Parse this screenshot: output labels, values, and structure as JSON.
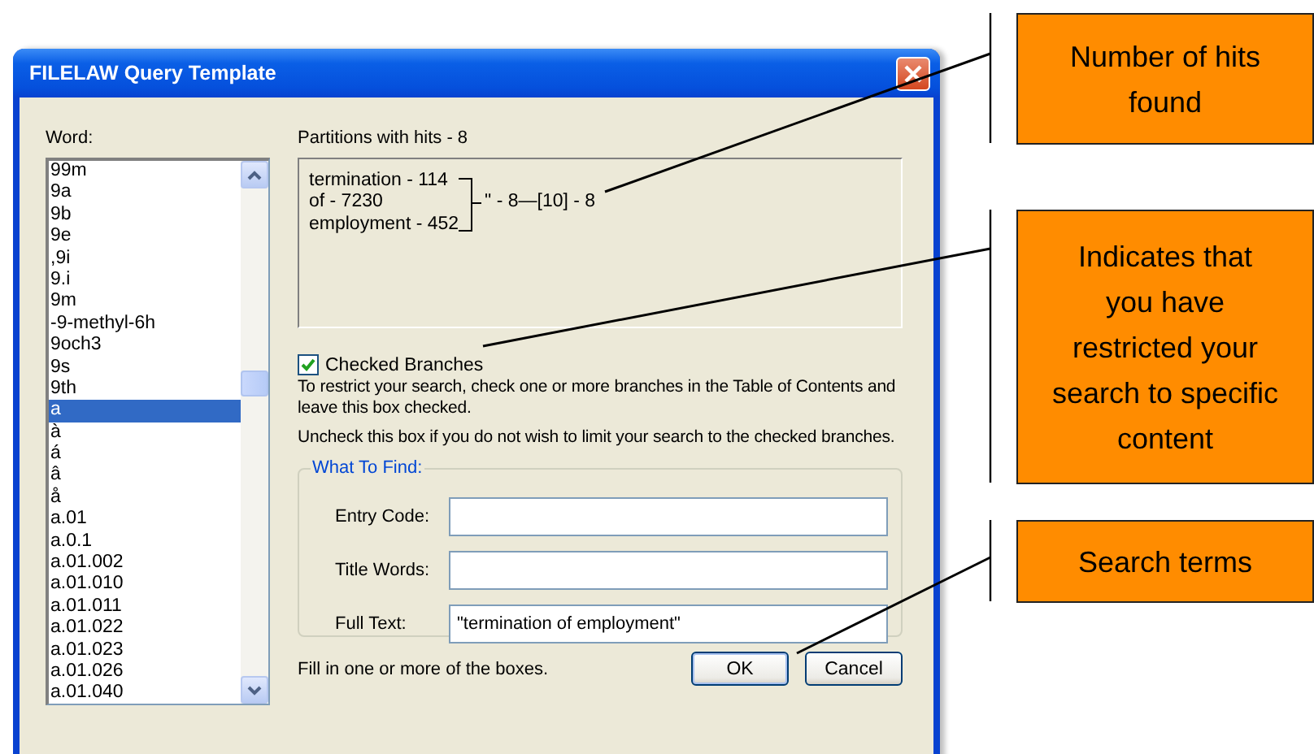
{
  "window": {
    "title": "FILELAW Query Template"
  },
  "word_list": {
    "label": "Word:",
    "items": [
      {
        "text": "99m",
        "selected": false
      },
      {
        "text": "9a",
        "selected": false
      },
      {
        "text": "9b",
        "selected": false
      },
      {
        "text": "9e",
        "selected": false
      },
      {
        "text": ",9i",
        "selected": false
      },
      {
        "text": "9.i",
        "selected": false
      },
      {
        "text": "9m",
        "selected": false
      },
      {
        "text": "-9-methyl-6h",
        "selected": false
      },
      {
        "text": "9och3",
        "selected": false
      },
      {
        "text": "9s",
        "selected": false
      },
      {
        "text": "9th",
        "selected": false
      },
      {
        "text": "a",
        "selected": true
      },
      {
        "text": "à",
        "selected": false
      },
      {
        "text": "á",
        "selected": false
      },
      {
        "text": "â",
        "selected": false
      },
      {
        "text": "å",
        "selected": false
      },
      {
        "text": "a.01",
        "selected": false
      },
      {
        "text": "a.0.1",
        "selected": false
      },
      {
        "text": "a.01.002",
        "selected": false
      },
      {
        "text": "a.01.010",
        "selected": false
      },
      {
        "text": "a.01.011",
        "selected": false
      },
      {
        "text": "a.01.022",
        "selected": false
      },
      {
        "text": "a.01.023",
        "selected": false
      },
      {
        "text": "a.01.026",
        "selected": false
      },
      {
        "text": "a.01.040",
        "selected": false
      }
    ]
  },
  "partitions": {
    "label": "Partitions with hits - 8",
    "terms": [
      "termination - 114",
      "of - 7230",
      "employment - 452"
    ],
    "result": "\" - 8—[10] - 8"
  },
  "checked_branches": {
    "label": "Checked Branches",
    "checked": true
  },
  "help_texts": [
    "To restrict your search, check one or more branches in the Table of Contents and leave this box checked.",
    "Uncheck this box if you do not wish to limit your search to the checked branches."
  ],
  "what_to_find": {
    "title": "What To Find:",
    "fields": [
      {
        "label": "Entry Code:"
      },
      {
        "label": "Title Words:"
      },
      {
        "label": "Full Text:",
        "value": "\"termination of employment\""
      }
    ]
  },
  "footer_hint": "Fill in one or more of the boxes.",
  "buttons": [
    {
      "label": "OK",
      "default": true
    },
    {
      "label": "Cancel",
      "default": false
    }
  ],
  "callouts": [
    {
      "text": "Number of hits found"
    },
    {
      "text": "Indicates that you have restricted your search to specific content"
    },
    {
      "text": "Search terms"
    }
  ]
}
